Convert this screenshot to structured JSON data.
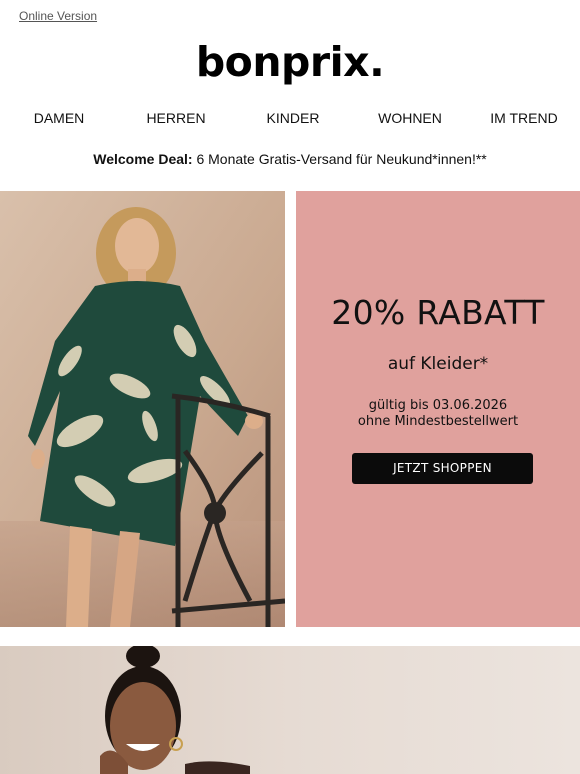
{
  "header": {
    "online_version": "Online Version",
    "logo": "bonprix."
  },
  "nav": {
    "items": [
      {
        "label": "DAMEN"
      },
      {
        "label": "HERREN"
      },
      {
        "label": "KINDER"
      },
      {
        "label": "WOHNEN"
      },
      {
        "label": "IM TREND"
      }
    ]
  },
  "welcome": {
    "bold": "Welcome Deal:",
    "text": " 6 Monate Gratis-Versand für Neukund*innen!**"
  },
  "promo": {
    "title": "20% RABATT",
    "subtitle": "auf Kleider*",
    "valid_line": "gültig bis 03.06.2026",
    "minimum_line": "ohne Mindestbestellwert",
    "cta_label": "JETZT SHOPPEN",
    "background_color": "#e0a19d",
    "cta_color": "#0b0b0b"
  },
  "images": {
    "hero": "woman-in-green-leaf-print-dress-photo",
    "second": "smiling-woman-portrait-photo"
  }
}
